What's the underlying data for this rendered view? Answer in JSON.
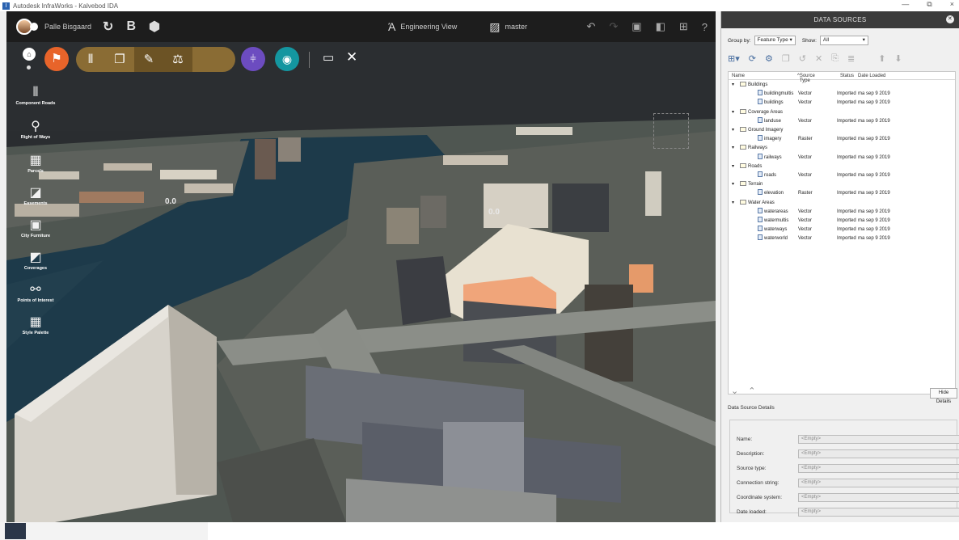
{
  "window": {
    "title": "Autodesk InfraWorks - Kalvebod IDA",
    "controls": [
      "—",
      "⧉",
      "×"
    ]
  },
  "topbar": {
    "user_name": "Palle Bisgaard",
    "view_label": "Engineering View",
    "branch_label": "master"
  },
  "left_tools": [
    {
      "label": "Component Roads",
      "icon": "road-icon",
      "glyph": "⫴"
    },
    {
      "label": "Right of Ways",
      "icon": "right-of-way-icon",
      "glyph": "⚲"
    },
    {
      "label": "Parcels",
      "icon": "parcel-icon",
      "glyph": "▦"
    },
    {
      "label": "Easements",
      "icon": "easement-icon",
      "glyph": "◪"
    },
    {
      "label": "City Furniture",
      "icon": "city-furniture-icon",
      "glyph": "▣"
    },
    {
      "label": "Coverages",
      "icon": "coverage-icon",
      "glyph": "◩"
    },
    {
      "label": "Points of Interest",
      "icon": "poi-icon",
      "glyph": "⚯"
    },
    {
      "label": "Style Palette",
      "icon": "style-palette-icon",
      "glyph": "▦"
    }
  ],
  "viewport": {
    "value_label_1": "0.0",
    "value_label_2": "0.0"
  },
  "panel": {
    "title": "DATA SOURCES",
    "group_by_label": "Group by:",
    "group_by_value": "Feature Type",
    "show_label": "Show:",
    "show_value": "All",
    "columns": [
      "Name",
      "Source Type",
      "Status",
      "Date Loaded"
    ],
    "tree": [
      {
        "group": "Buildings",
        "items": [
          {
            "name": "buildingmultis",
            "type": "Vector",
            "status": "Imported",
            "date": "ma sep 9 2019"
          },
          {
            "name": "buildings",
            "type": "Vector",
            "status": "Imported",
            "date": "ma sep 9 2019"
          }
        ]
      },
      {
        "group": "Coverage Areas",
        "items": [
          {
            "name": "landuse",
            "type": "Vector",
            "status": "Imported",
            "date": "ma sep 9 2019"
          }
        ]
      },
      {
        "group": "Ground Imagery",
        "items": [
          {
            "name": "imagery",
            "type": "Raster",
            "status": "Imported",
            "date": "ma sep 9 2019"
          }
        ]
      },
      {
        "group": "Railways",
        "items": [
          {
            "name": "railways",
            "type": "Vector",
            "status": "Imported",
            "date": "ma sep 9 2019"
          }
        ]
      },
      {
        "group": "Roads",
        "items": [
          {
            "name": "roads",
            "type": "Vector",
            "status": "Imported",
            "date": "ma sep 9 2019"
          }
        ]
      },
      {
        "group": "Terrain",
        "items": [
          {
            "name": "elevation",
            "type": "Raster",
            "status": "Imported",
            "date": "ma sep 9 2019"
          }
        ]
      },
      {
        "group": "Water Areas",
        "items": [
          {
            "name": "waterareas",
            "type": "Vector",
            "status": "Imported",
            "date": "ma sep 9 2019"
          },
          {
            "name": "watermultis",
            "type": "Vector",
            "status": "Imported",
            "date": "ma sep 9 2019"
          },
          {
            "name": "waterways",
            "type": "Vector",
            "status": "Imported",
            "date": "ma sep 9 2019"
          },
          {
            "name": "waterworld",
            "type": "Vector",
            "status": "Imported",
            "date": "ma sep 9 2019"
          }
        ]
      }
    ],
    "hide_details_label": "Hide Details",
    "details_title": "Data Source Details",
    "details": [
      {
        "label": "Name:",
        "value": "<Empty>"
      },
      {
        "label": "Description:",
        "value": "<Empty>"
      },
      {
        "label": "Source type:",
        "value": "<Empty>"
      },
      {
        "label": "Connection string:",
        "value": "<Empty>"
      },
      {
        "label": "Coordinate system:",
        "value": "<Empty>"
      },
      {
        "label": "Date loaded:",
        "value": "<Empty>"
      }
    ]
  },
  "colors": {
    "accent_orange": "#e8642a",
    "tool_gold": "#8a6c34",
    "purple": "#6c4cc0",
    "teal": "#1496a0"
  }
}
